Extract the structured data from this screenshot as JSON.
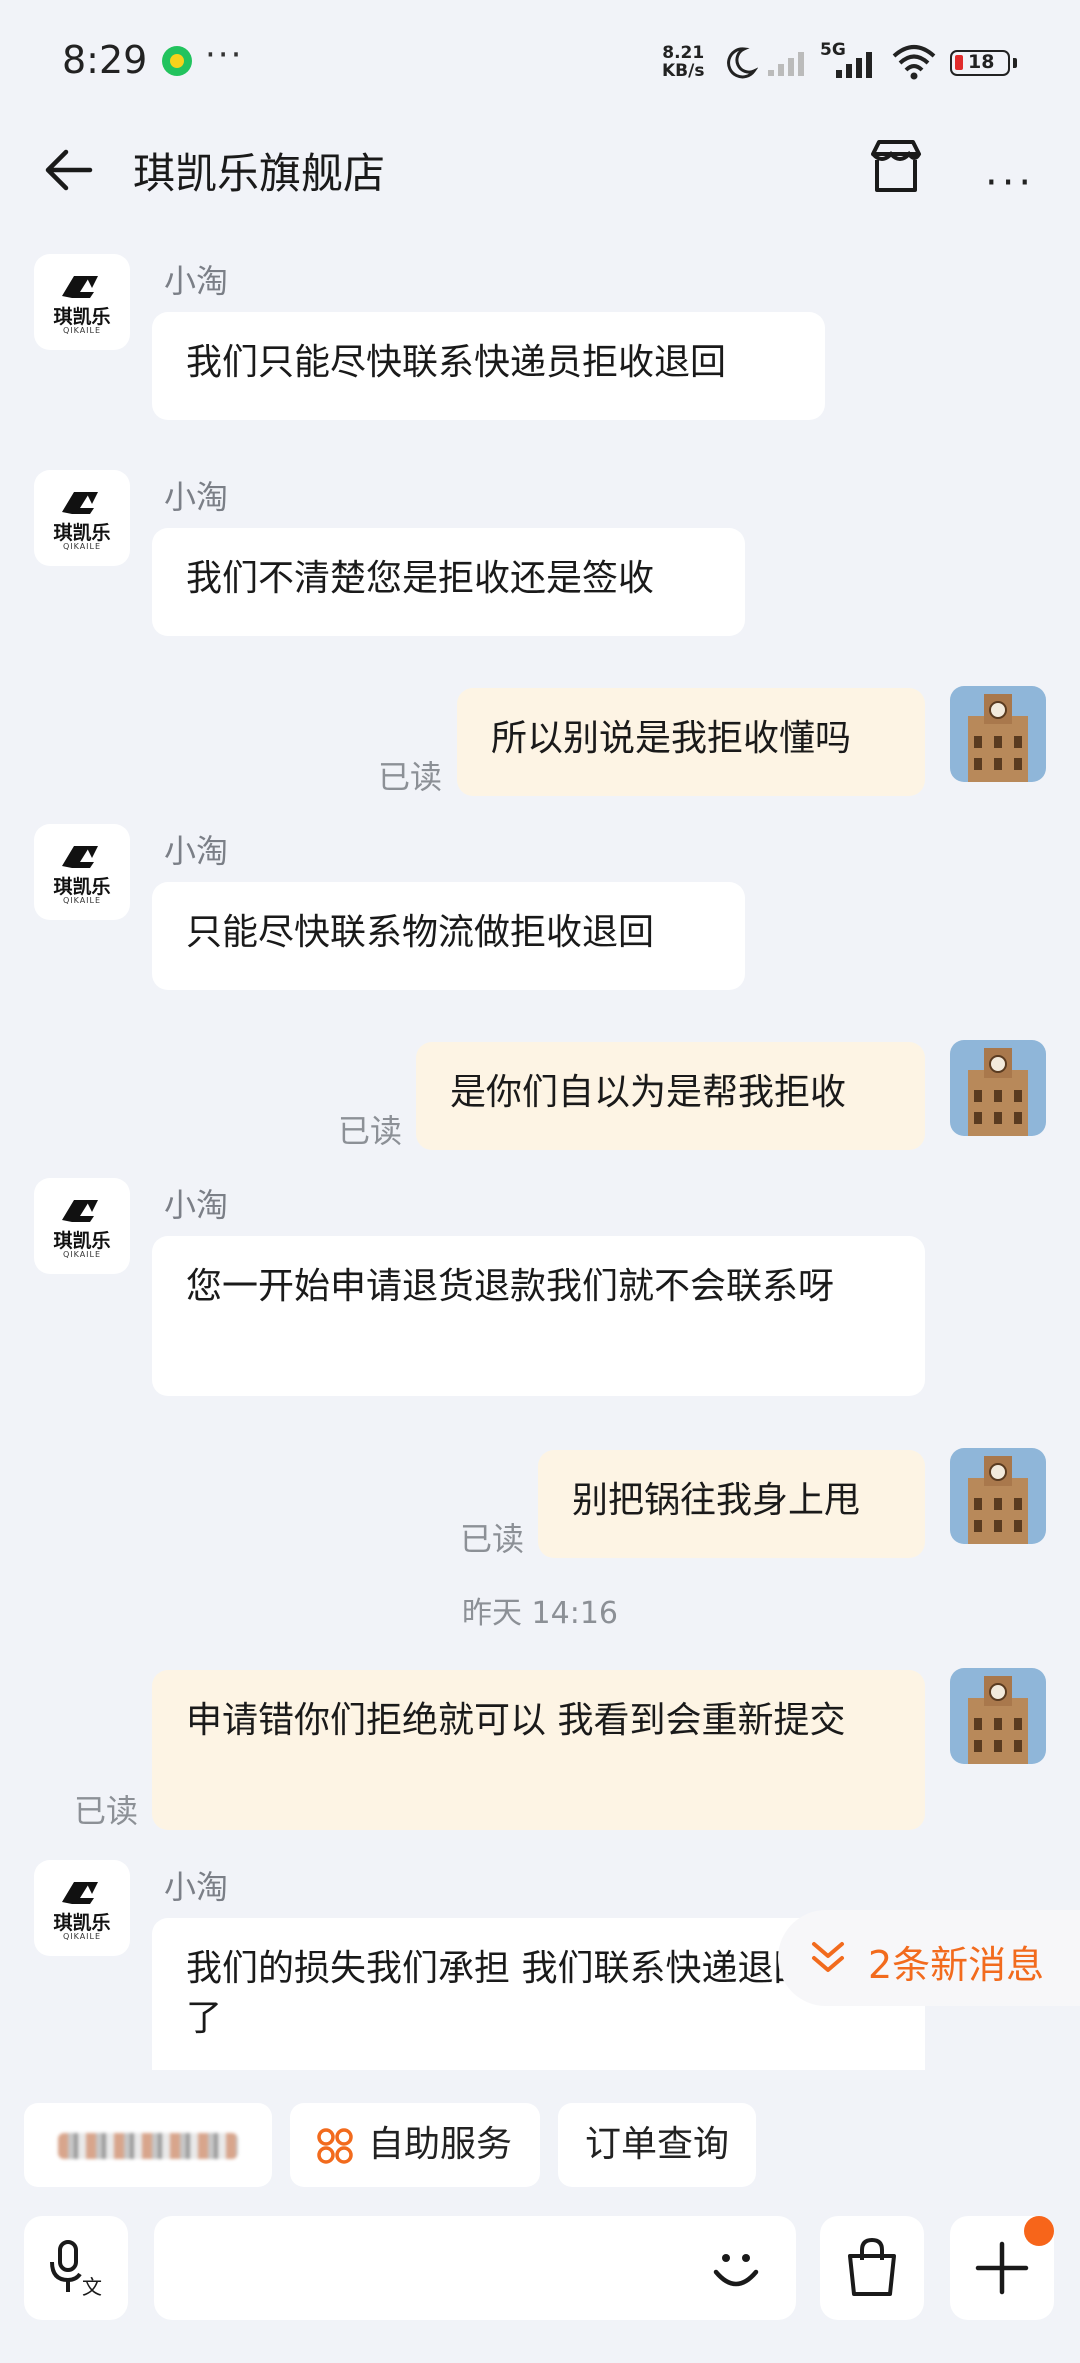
{
  "status_bar": {
    "time": "8:29",
    "app_dots": "···",
    "net_speed_value": "8.21",
    "net_speed_unit": "KB/s",
    "network": "5G",
    "battery": "18"
  },
  "header": {
    "title": "琪凯乐旗舰店",
    "back_icon": "arrow-left-icon",
    "shop_icon": "store-icon",
    "more_label": "···"
  },
  "shop_logo": {
    "brand": "琪凯乐",
    "sub": "QIKAILE"
  },
  "messages": [
    {
      "side": "in",
      "sender": "小淘",
      "text": "我们只能尽快联系快递员拒收退回"
    },
    {
      "side": "in",
      "sender": "小淘",
      "text": "我们不清楚您是拒收还是签收"
    },
    {
      "side": "out",
      "read": "已读",
      "text": "所以别说是我拒收懂吗"
    },
    {
      "side": "in",
      "sender": "小淘",
      "text": "只能尽快联系物流做拒收退回"
    },
    {
      "side": "out",
      "read": "已读",
      "text": "是你们自以为是帮我拒收"
    },
    {
      "side": "in",
      "sender": "小淘",
      "text": "您一开始申请退货退款我们就不会联系呀"
    },
    {
      "side": "out",
      "read": "已读",
      "text": "别把锅往我身上甩"
    },
    {
      "type": "timestamp",
      "text": "昨天 14:16"
    },
    {
      "side": "out",
      "read": "已读",
      "text": "申请错你们拒绝就可以 我看到会重新提交"
    },
    {
      "side": "in",
      "sender": "小淘",
      "text": "我们的损失我们承担  我们联系快递退回就行了"
    }
  ],
  "new_messages": {
    "label": "2条新消息",
    "icon": "double-chevron-down-icon",
    "color": "#f26b1d"
  },
  "quick_actions": [
    {
      "label": "",
      "note": "blurred"
    },
    {
      "label": "自助服务",
      "icon": "grid-flower-icon"
    },
    {
      "label": "订单查询"
    }
  ],
  "input_bar": {
    "voice_icon": "microphone-translate-icon",
    "emoji_icon": "smile-icon",
    "bag_icon": "shopping-bag-icon",
    "plus_icon": "plus-icon"
  },
  "colors": {
    "background": "#f1f3f8",
    "incoming_bubble": "#ffffff",
    "outgoing_bubble": "#fdf4e4",
    "accent": "#f26b1d"
  }
}
